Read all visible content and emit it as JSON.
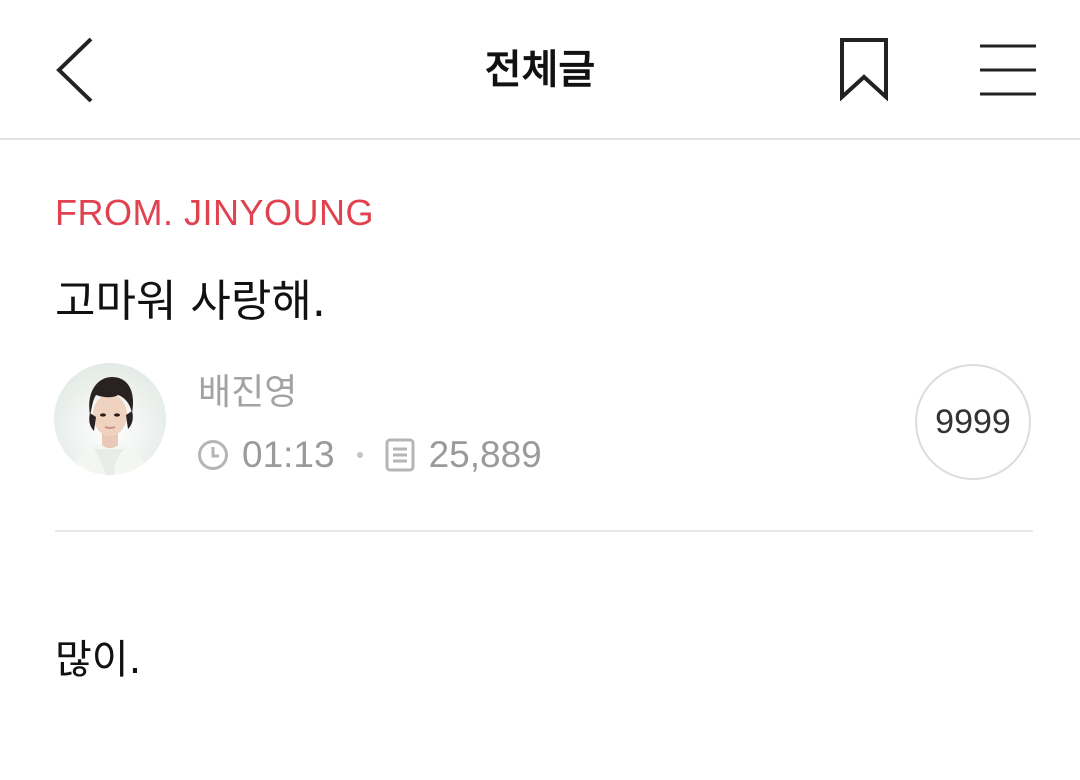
{
  "header": {
    "title": "전체글",
    "back_icon": "chevron-left-icon",
    "bookmark_icon": "bookmark-icon",
    "menu_icon": "hamburger-menu-icon"
  },
  "post": {
    "category": "FROM. JINYOUNG",
    "title": "고마워 사랑해.",
    "author": "배진영",
    "time": "01:13",
    "views": "25,889",
    "likes": "9999",
    "body": "많이."
  },
  "colors": {
    "accent": "#e0424f",
    "meta_gray": "#9a9a9a",
    "divider": "#e8e8e8"
  }
}
